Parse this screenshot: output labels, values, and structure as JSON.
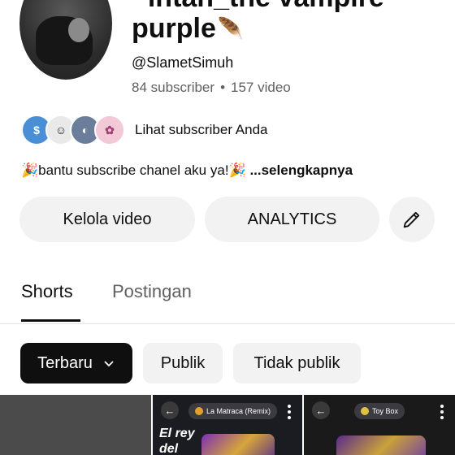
{
  "channel": {
    "name_line1": "~intan_the vampire",
    "name_line2": "purple",
    "name_emoji": "🪶",
    "handle": "@SlametSimuh",
    "subscribers": "84 subscriber",
    "separator": "•",
    "videos": "157 video"
  },
  "subscribers_row": {
    "label": "Lihat subscriber Anda",
    "avatars": [
      "$",
      "☺",
      "◐",
      "✿"
    ]
  },
  "description": {
    "text": "🎉bantu subscribe chanel aku ya!🎉 ",
    "more": "...selengkapnya"
  },
  "actions": {
    "manage_label": "Kelola video",
    "analytics_label": "ANALYTICS",
    "edit_icon": "pencil-icon"
  },
  "tabs": [
    {
      "label": "Shorts",
      "active": true
    },
    {
      "label": "Postingan",
      "active": false
    }
  ],
  "filters": {
    "newest": "Terbaru",
    "public": "Publik",
    "private": "Tidak publik"
  },
  "thumbnails": [
    {
      "song": "",
      "text": ""
    },
    {
      "song": "La Matraca (Remix)",
      "text": "El rey del Morbo"
    },
    {
      "song": "Toy Box",
      "text": ""
    }
  ],
  "colors": {
    "primary_text": "#0f0f0f",
    "secondary_text": "#606060",
    "chip_bg": "#f2f2f2",
    "active_chip_bg": "#0f0f0f"
  }
}
